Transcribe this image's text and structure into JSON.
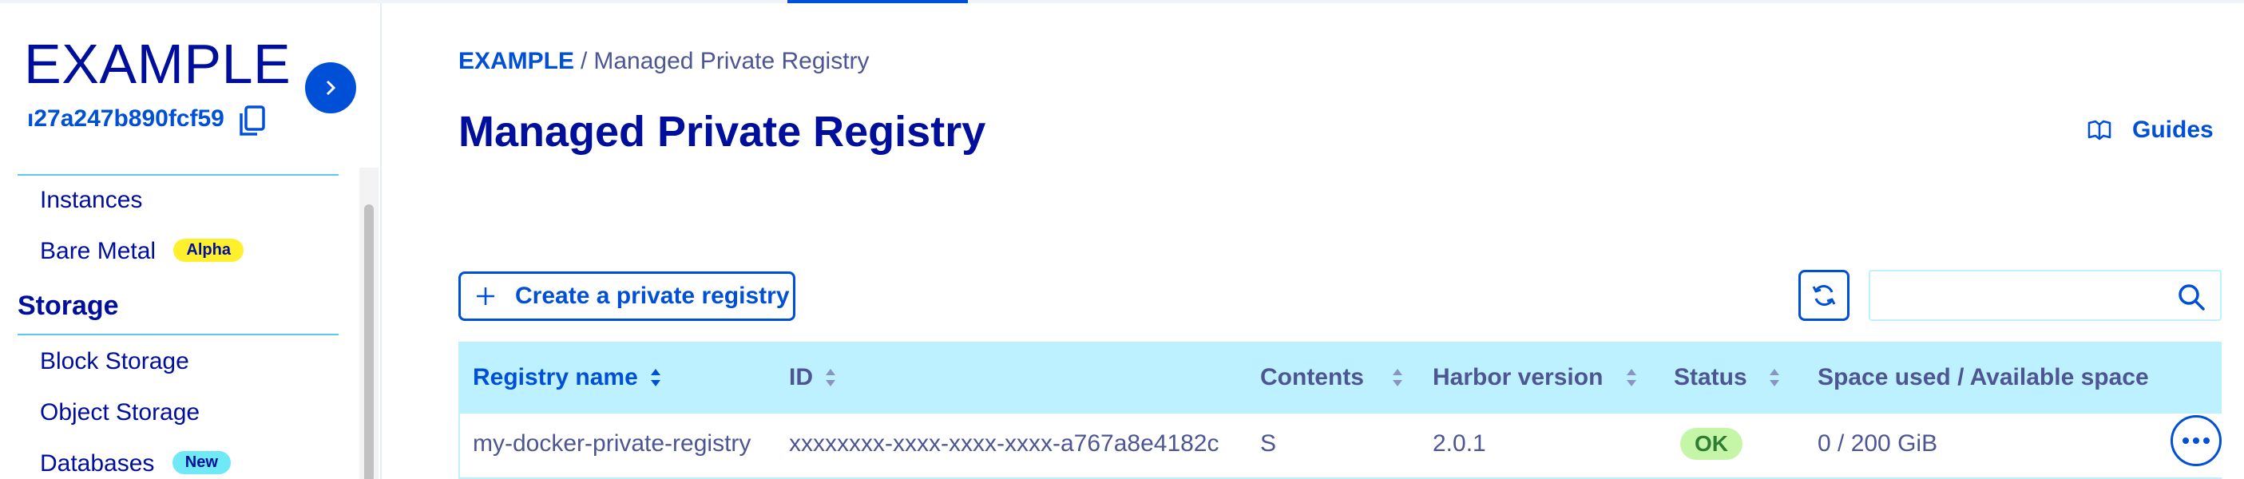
{
  "sidebar": {
    "project_title": "EXAMPLE",
    "project_id": "ı27a247b890fcf59",
    "items": [
      {
        "type": "item",
        "label": "Instances",
        "badge": null
      },
      {
        "type": "item",
        "label": "Bare Metal",
        "badge": "Alpha"
      },
      {
        "type": "section",
        "label": "Storage"
      },
      {
        "type": "item",
        "label": "Block Storage",
        "badge": null
      },
      {
        "type": "item",
        "label": "Object Storage",
        "badge": null
      },
      {
        "type": "item",
        "label": "Databases",
        "badge": "New"
      }
    ]
  },
  "breadcrumb": {
    "root": "EXAMPLE",
    "separator": "/",
    "current": "Managed Private Registry"
  },
  "header": {
    "title": "Managed Private Registry",
    "guides_label": "Guides"
  },
  "toolbar": {
    "create_label": "Create a private registry",
    "search_value": ""
  },
  "table": {
    "columns": [
      {
        "label": "Registry name",
        "sortable": true
      },
      {
        "label": "ID",
        "sortable": true
      },
      {
        "label": "Contents",
        "sortable": true
      },
      {
        "label": "Harbor version",
        "sortable": true
      },
      {
        "label": "Status",
        "sortable": true
      },
      {
        "label": "Space used / Available space",
        "sortable": false
      }
    ],
    "rows": [
      {
        "name": "my-docker-private-registry",
        "id": "xxxxxxxx-xxxx-xxxx-xxxx-a767a8e4182c",
        "contents": "S",
        "harbor_version": "2.0.1",
        "status": "OK",
        "space": "0 / 200 GiB"
      }
    ]
  },
  "colors": {
    "primary": "#0050d7",
    "text_dark": "#000e9c",
    "header_bg": "#bef1ff",
    "status_ok_bg": "#c5f6a8",
    "badge_alpha": "#fff02e",
    "badge_new": "#6fe9f5"
  }
}
